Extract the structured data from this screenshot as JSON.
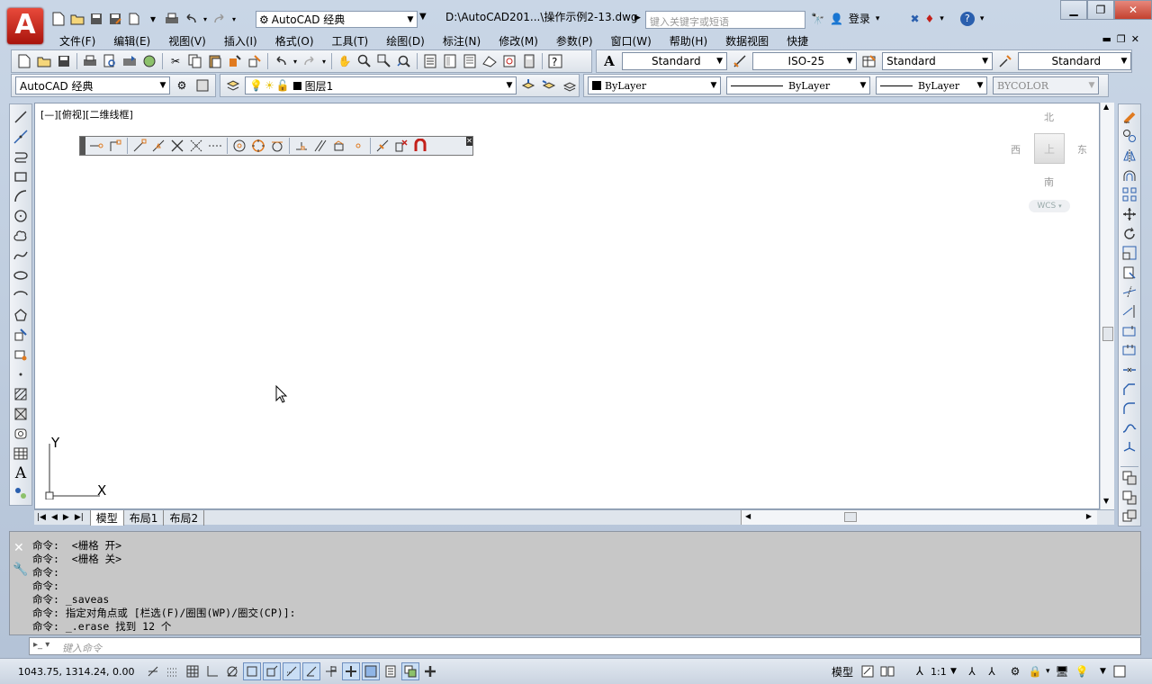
{
  "app": {
    "logo_letter": "A",
    "workspace": "AutoCAD 经典",
    "title": "D:\\AutoCAD201...\\操作示例2-13.dwg",
    "search_placeholder": "键入关键字或短语",
    "login": "登录"
  },
  "menu": [
    "文件(F)",
    "编辑(E)",
    "视图(V)",
    "插入(I)",
    "格式(O)",
    "工具(T)",
    "绘图(D)",
    "标注(N)",
    "修改(M)",
    "参数(P)",
    "窗口(W)",
    "帮助(H)",
    "数据视图",
    "快捷"
  ],
  "styles": {
    "text_style": "Standard",
    "dim_style": "ISO-25",
    "table_style": "Standard",
    "multileader_style": "Standard"
  },
  "layers": {
    "workspace": "AutoCAD 经典",
    "current_layer": "图层1",
    "color": "ByLayer",
    "linetype": "ByLayer",
    "lineweight": "ByLayer",
    "plotstyle": "BYCOLOR"
  },
  "viewport": {
    "label": "[—][俯视][二维线框]",
    "cube": {
      "north": "北",
      "south": "南",
      "east": "东",
      "west": "西",
      "face": "上",
      "wcs": "WCS"
    },
    "ucs": {
      "x": "X",
      "y": "Y"
    }
  },
  "tabs": [
    "模型",
    "布局1",
    "布局2"
  ],
  "command_history": [
    "命令:  <栅格 开>",
    "命令:  <栅格 关>",
    "命令:",
    "命令:",
    "命令: _saveas",
    "命令: 指定对角点或 [栏选(F)/圈围(WP)/圈交(CP)]:",
    "命令: _.erase 找到 12 个"
  ],
  "command_placeholder": "键入命令",
  "status": {
    "coords": "1043.75, 1314.24, 0.00",
    "model_label": "模型",
    "scale": "1:1"
  },
  "colors": {
    "accent": "#c3201a",
    "icon_orange": "#e07a1f",
    "icon_blue": "#2a5fae"
  }
}
